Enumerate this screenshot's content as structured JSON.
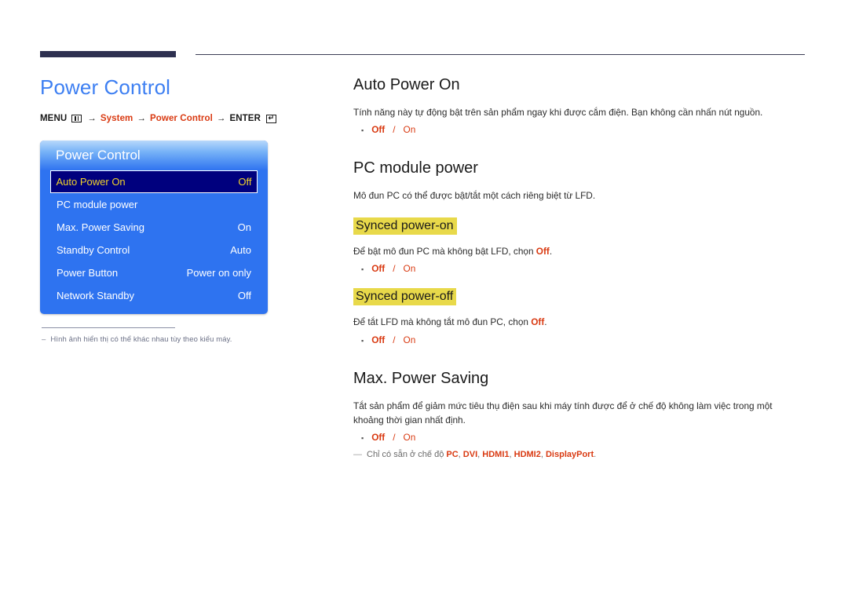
{
  "doc": {
    "title": "Power Control",
    "breadcrumb": {
      "menu_label": "MENU",
      "menu_icon": "menu-grid-icon",
      "arrow": "→",
      "step1": "System",
      "step2": "Power Control",
      "enter_label": "ENTER",
      "enter_icon": "enter-key-icon"
    },
    "footnote": {
      "dash": "–",
      "text": "Hình ảnh hiển thị có thể khác nhau tùy theo kiểu máy."
    }
  },
  "osd": {
    "title": "Power Control",
    "rows": [
      {
        "label": "Auto Power On",
        "value": "Off",
        "selected": true
      },
      {
        "label": "PC module power",
        "value": "",
        "selected": false
      },
      {
        "label": "Max. Power Saving",
        "value": "On",
        "selected": false
      },
      {
        "label": "Standby Control",
        "value": "Auto",
        "selected": false
      },
      {
        "label": "Power Button",
        "value": "Power on only",
        "selected": false
      },
      {
        "label": "Network Standby",
        "value": "Off",
        "selected": false
      }
    ]
  },
  "sections": {
    "auto_power_on": {
      "heading": "Auto Power On",
      "body": "Tính năng này tự động bật trên sản phẩm ngay khi được cắm điện. Bạn không cần nhấn nút nguồn.",
      "option_off": "Off",
      "option_sep": "/",
      "option_on": "On"
    },
    "pc_module_power": {
      "heading": "PC module power",
      "body": "Mô đun PC có thể được bật/tắt một cách riêng biệt từ LFD.",
      "synced_on": {
        "heading": "Synced power-on",
        "body_pre": "Để bật mô đun PC mà không bật LFD, chọn ",
        "body_accent": "Off",
        "body_post": ".",
        "option_off": "Off",
        "option_sep": "/",
        "option_on": "On"
      },
      "synced_off": {
        "heading": "Synced power-off",
        "body_pre": "Để tắt LFD mà không tắt mô đun PC, chọn ",
        "body_accent": "Off",
        "body_post": ".",
        "option_off": "Off",
        "option_sep": "/",
        "option_on": "On"
      }
    },
    "max_power_saving": {
      "heading": "Max. Power Saving",
      "body": "Tắt sản phẩm để giảm mức tiêu thụ điện sau khi máy tính được để ở chế độ không làm việc trong một khoảng thời gian nhất định.",
      "option_off": "Off",
      "option_sep": "/",
      "option_on": "On",
      "note": {
        "dash": "—",
        "pre": "Chỉ có sẵn ở chế độ ",
        "modes": [
          "PC",
          "DVI",
          "HDMI1",
          "HDMI2",
          "DisplayPort"
        ],
        "post": "."
      }
    }
  },
  "colors": {
    "title_blue": "#3d7ff2",
    "accent_red": "#d93a12",
    "osd_blue": "#2e73f0",
    "osd_selected_bg": "#00007e",
    "osd_selected_text": "#f2d32a",
    "highlight_yellow": "#e8d94a",
    "rule_navy": "#2e3050"
  }
}
